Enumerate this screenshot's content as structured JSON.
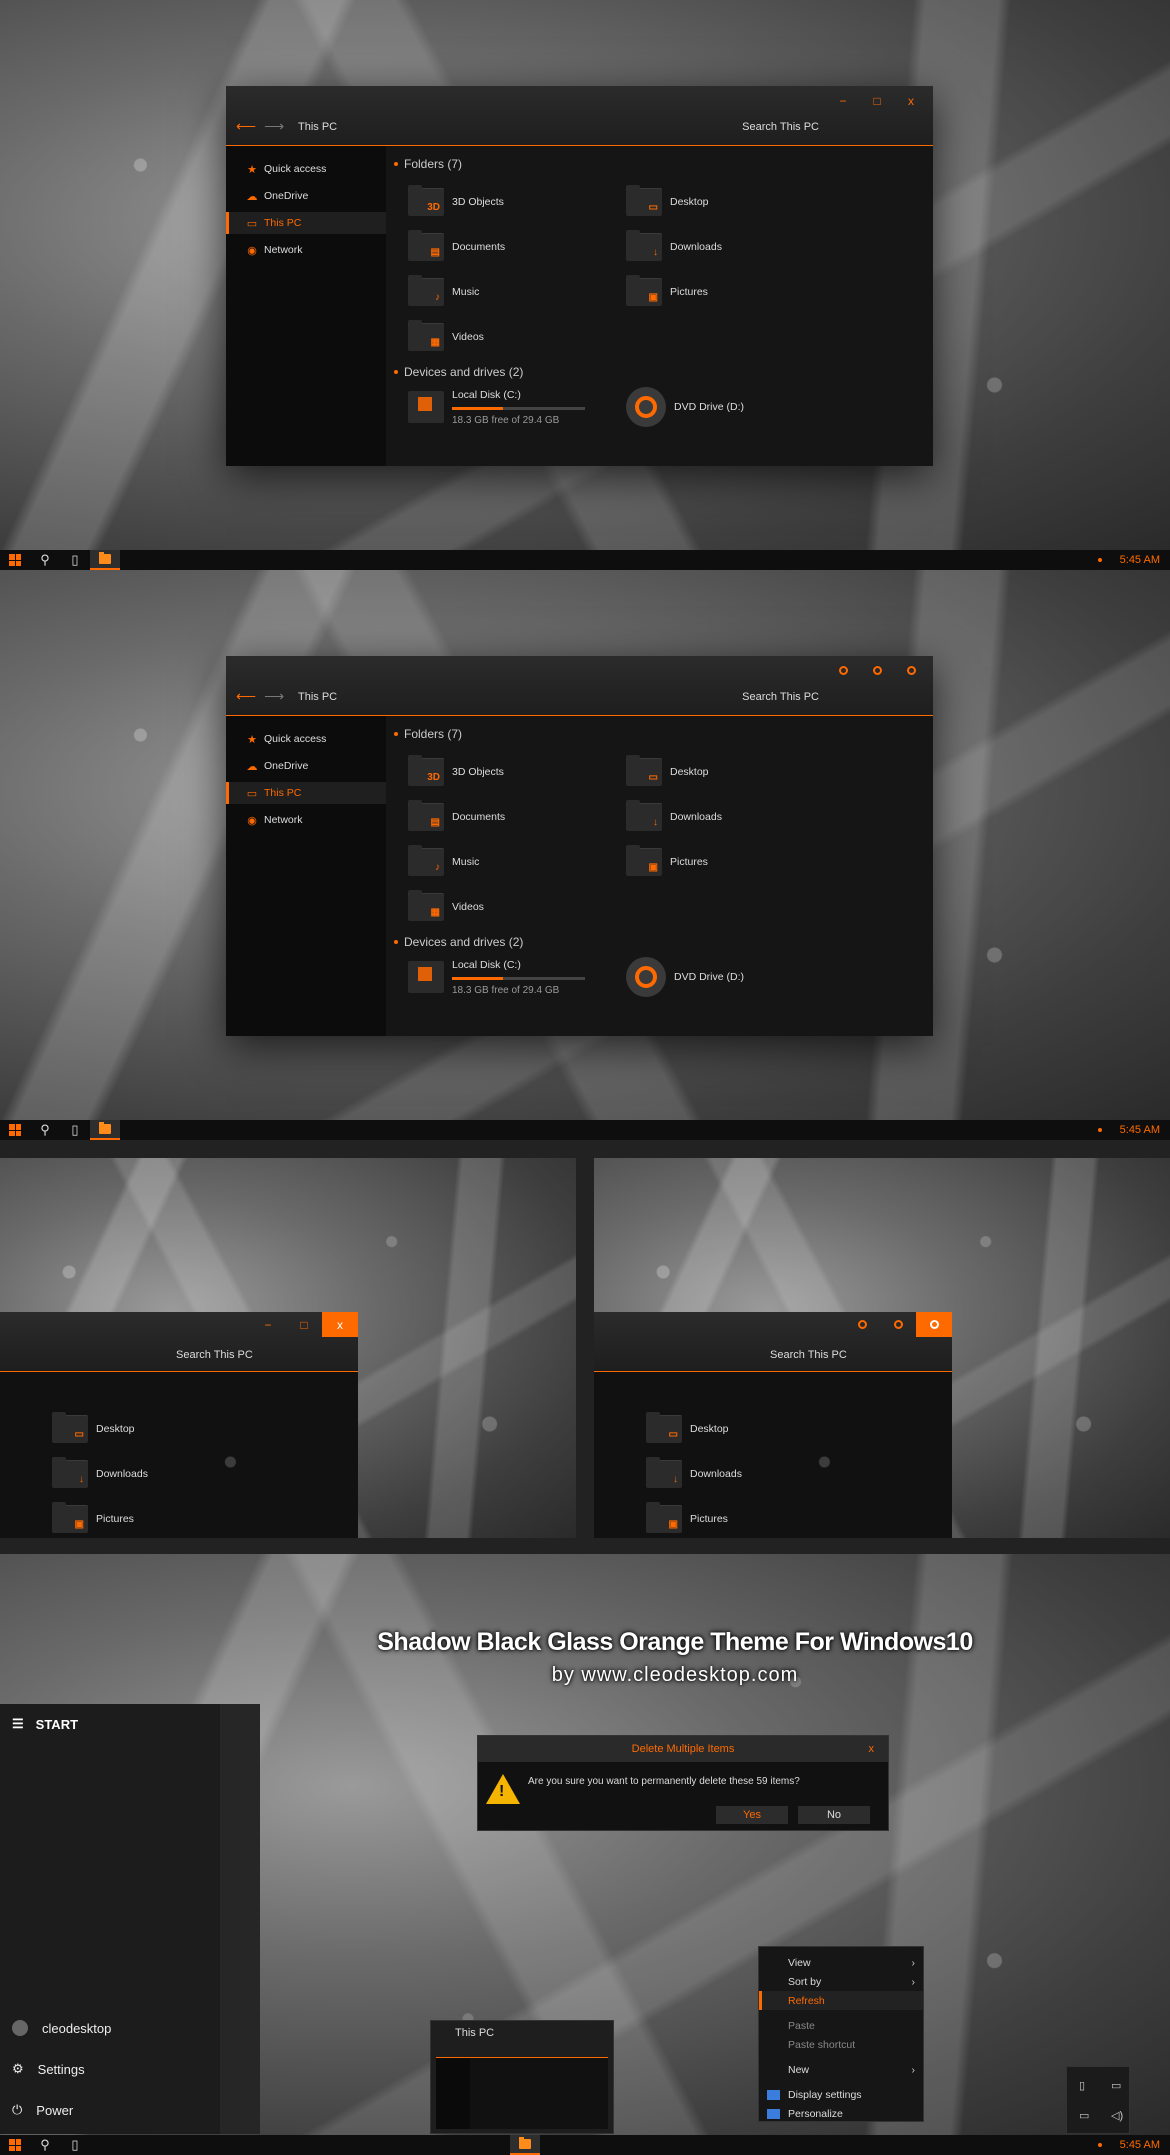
{
  "explorer": {
    "nav_back": "⟵",
    "nav_forward": "⟶",
    "title": "This PC",
    "search_placeholder": "Search This PC",
    "controls": {
      "minimize": "−",
      "maximize": "□",
      "close": "x"
    },
    "sidebar": [
      {
        "label": "Quick access",
        "icon": "star-icon",
        "glyph": "★"
      },
      {
        "label": "OneDrive",
        "icon": "cloud-icon",
        "glyph": "☁"
      },
      {
        "label": "This PC",
        "icon": "monitor-icon",
        "glyph": "▭"
      },
      {
        "label": "Network",
        "icon": "network-icon",
        "glyph": "◉"
      }
    ],
    "folders_heading": "Folders (7)",
    "folders": [
      {
        "label": "3D Objects",
        "glyph": "3D"
      },
      {
        "label": "Desktop",
        "glyph": "▭"
      },
      {
        "label": "Documents",
        "glyph": "▤"
      },
      {
        "label": "Downloads",
        "glyph": "↓"
      },
      {
        "label": "Music",
        "glyph": "♪"
      },
      {
        "label": "Pictures",
        "glyph": "▣"
      },
      {
        "label": "Videos",
        "glyph": "▦"
      }
    ],
    "drives_heading": "Devices and drives (2)",
    "local_disk": {
      "label": "Local Disk (C:)",
      "free_text": "18.3 GB free of 29.4 GB",
      "used_fraction": 0.38
    },
    "dvd": {
      "label": "DVD Drive (D:)"
    }
  },
  "taskbar": {
    "clock": "5:45 AM"
  },
  "crop_items": [
    {
      "label": "Desktop",
      "glyph": "▭"
    },
    {
      "label": "Downloads",
      "glyph": "↓"
    },
    {
      "label": "Pictures",
      "glyph": "▣"
    }
  ],
  "headline": "Shadow Black Glass Orange Theme For Windows10",
  "subline": "by www.cleodesktop.com",
  "start": {
    "title": "START",
    "user": "cleodesktop",
    "settings": "Settings",
    "power": "Power"
  },
  "dialog": {
    "title": "Delete Multiple Items",
    "close": "x",
    "message": "Are you sure you want to permanently delete these 59 items?",
    "yes": "Yes",
    "no": "No"
  },
  "context_menu": {
    "view": "View",
    "sort_by": "Sort by",
    "refresh": "Refresh",
    "paste": "Paste",
    "paste_shortcut": "Paste shortcut",
    "new": "New",
    "display_settings": "Display settings",
    "personalize": "Personalize"
  },
  "thumbnail": {
    "title": "This PC"
  },
  "colors": {
    "accent": "#ff6a00",
    "background": "#111111"
  }
}
